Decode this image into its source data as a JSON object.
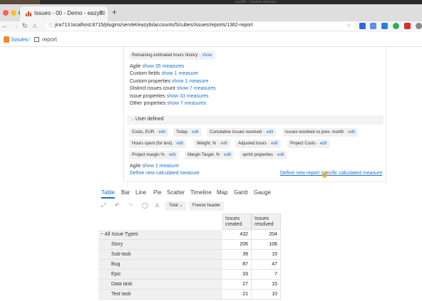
{
  "browser": {
    "tab_title": "Issues - 00 - Demo - eazyBI",
    "tab_close": "×",
    "new_tab": "+",
    "url": "jira713.localhost:8715/plugins/servlet/eazybi/accounts/5/cubes/Issues/reports/1362-report",
    "faint_title": "eazyBI - Custom measure"
  },
  "app": {
    "breadcrumb_issues": "Issues",
    "breadcrumb_sep": "/",
    "breadcrumb_report": "report"
  },
  "measures": {
    "remaining_chip": {
      "label": "Remaining estimated hours history",
      "action": "show"
    },
    "groups": [
      {
        "name": "Agile",
        "link": "show 35 measures"
      },
      {
        "name": "Custom fields",
        "link": "show 1 measure"
      },
      {
        "name": "Custom properties",
        "link": "show 1 measure"
      },
      {
        "name": "Distinct issues count",
        "link": "show 7 measures"
      },
      {
        "name": "Issue properties",
        "link": "show 33 measures"
      },
      {
        "name": "Other properties",
        "link": "show 7 measures"
      }
    ],
    "user_defined_header": "User defined",
    "user_defined_chips": [
      {
        "label": "Costs, EUR",
        "action": "edit"
      },
      {
        "label": "Today",
        "action": "edit"
      },
      {
        "label": "Cumulative Issues resolved",
        "action": "edit"
      },
      {
        "label": "Issues resolved vs prev. month",
        "action": "edit"
      },
      {
        "label": "Hours spent (for test)",
        "action": "edit"
      },
      {
        "label": "Weight, %",
        "action": "edit"
      },
      {
        "label": "Adjusted hours",
        "action": "edit"
      },
      {
        "label": "Project Costs",
        "action": "edit"
      },
      {
        "label": "Project margin %",
        "action": "edit"
      },
      {
        "label": "Margin Target, %",
        "action": "edit"
      },
      {
        "label": "sprint properties",
        "action": "edit"
      }
    ],
    "agile_bottom": {
      "name": "Agile",
      "link": "show 1 measure"
    },
    "define_new_measure": "Define new calculated measure",
    "define_report_measure": "Define new report specific calculated measure"
  },
  "report": {
    "view_tabs": [
      "Table",
      "Bar",
      "Line",
      "Pie",
      "Scatter",
      "Timeline",
      "Map",
      "Gantt",
      "Gauge"
    ],
    "active_tab": "Table",
    "total_button": "Total ⌄",
    "freeze_button": "Freeze header",
    "columns": [
      "Issues created",
      "Issues resolved"
    ],
    "rows": [
      {
        "label": "All Issue Types",
        "values": [
          "432",
          "204"
        ],
        "expanded": true
      },
      {
        "label": "Story",
        "values": [
          "206",
          "106"
        ]
      },
      {
        "label": "Sub-task",
        "values": [
          "39",
          "15"
        ]
      },
      {
        "label": "Bug",
        "values": [
          "87",
          "47"
        ]
      },
      {
        "label": "Epic",
        "values": [
          "33",
          "7"
        ]
      },
      {
        "label": "Data task",
        "values": [
          "27",
          "15"
        ]
      },
      {
        "label": "Test task",
        "values": [
          "21",
          "10"
        ]
      }
    ]
  },
  "colors": {
    "link": "#1a73c8",
    "brand": "#f08a24",
    "chip_bg": "#f1f1f1"
  }
}
